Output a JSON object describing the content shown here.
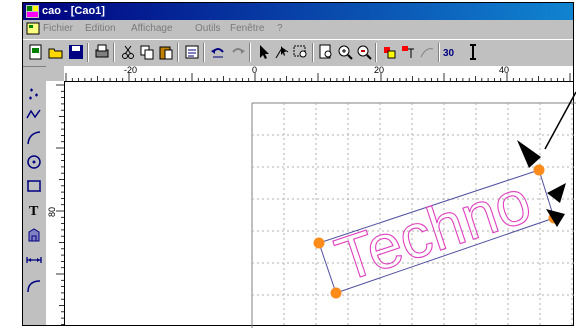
{
  "window": {
    "title": "cao - [Cao1]"
  },
  "menu": {
    "items": [
      "Fichier",
      "Edition",
      "Affichage",
      "Outils",
      "Fenêtre",
      "?"
    ]
  },
  "toolbar": {
    "icons": [
      "new-icon",
      "open-icon",
      "save-icon",
      "print-icon",
      "cut-icon",
      "copy-icon",
      "paste-icon",
      "properties-icon",
      "undo-icon",
      "redo-icon",
      "select-arrow-icon",
      "node-edit-icon",
      "zoom-window-icon",
      "zoom-page-icon",
      "zoom-in-icon",
      "zoom-out-icon",
      "layer-color-icon",
      "layer-icon",
      "measure-icon",
      "3d-button"
    ],
    "label_3d": "30"
  },
  "left_tools": [
    "point-tool-icon",
    "polyline-tool-icon",
    "curve-tool-icon",
    "circle-tool-icon",
    "rectangle-tool-icon",
    "text-tool-icon",
    "stamp-tool-icon",
    "dimension-tool-icon",
    "arc-tool-icon"
  ],
  "rulers": {
    "horizontal": {
      "labels": [
        "-20",
        "0",
        "20",
        "40"
      ]
    },
    "vertical": {
      "labels": [
        "80"
      ]
    }
  },
  "drawing": {
    "text": "Techno",
    "text_color": "#e040c0",
    "handle_color": "#ff8c1a"
  }
}
